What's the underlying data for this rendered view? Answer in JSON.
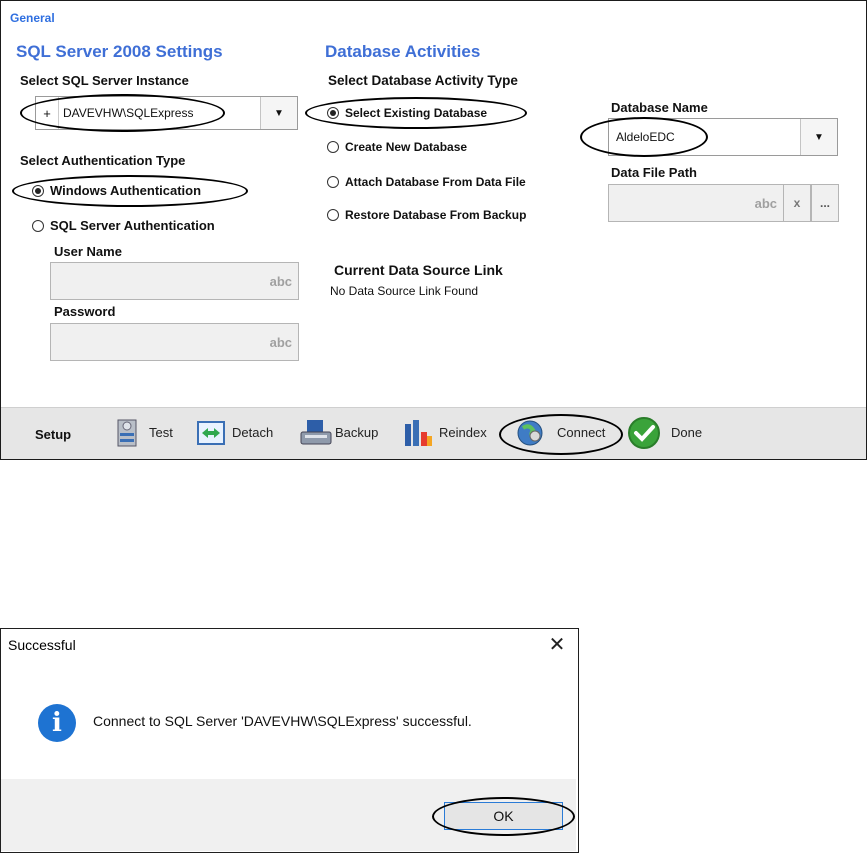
{
  "window": {
    "group_label": "General",
    "sql_section": {
      "title": "SQL Server 2008 Settings",
      "instance_label": "Select SQL Server Instance",
      "instance_prefix": "+",
      "instance_value": "DAVEVHW\\SQLExpress",
      "auth_label": "Select Authentication Type",
      "auth_options": [
        {
          "label": "Windows Authentication",
          "selected": true
        },
        {
          "label": "SQL Server Authentication",
          "selected": false
        }
      ],
      "username_label": "User Name",
      "username_hint": "abc",
      "password_label": "Password",
      "password_hint": "abc"
    },
    "db_section": {
      "title": "Database Activities",
      "activity_label": "Select Database Activity Type",
      "activities": [
        {
          "label": "Select Existing Database",
          "selected": true
        },
        {
          "label": "Create New Database",
          "selected": false
        },
        {
          "label": "Attach Database From Data File",
          "selected": false
        },
        {
          "label": "Restore Database From Backup",
          "selected": false
        }
      ],
      "db_name_label": "Database Name",
      "db_name_value": "AldeloEDC",
      "data_file_label": "Data File Path",
      "data_file_hint": "abc",
      "clear_label": "x",
      "browse_label": "...",
      "link_title": "Current Data Source Link",
      "link_value": "No Data Source Link Found"
    }
  },
  "toolbar": {
    "group": "Setup",
    "items": [
      {
        "label": "Test",
        "icon": "server-test-icon"
      },
      {
        "label": "Detach",
        "icon": "detach-arrows-icon"
      },
      {
        "label": "Backup",
        "icon": "backup-printer-icon"
      },
      {
        "label": "Reindex",
        "icon": "bar-chart-icon"
      },
      {
        "label": "Connect",
        "icon": "globe-connect-icon"
      },
      {
        "label": "Done",
        "icon": "green-check-icon"
      }
    ]
  },
  "dialog": {
    "title": "Successful",
    "close_glyph": "✕",
    "icon_glyph": "i",
    "message": "Connect to SQL Server 'DAVEVHW\\SQLExpress' successful.",
    "ok_label": "OK"
  },
  "colors": {
    "section_title": "#3f6fd6",
    "info_blue": "#1e73d2",
    "check_green": "#3aa33a"
  }
}
